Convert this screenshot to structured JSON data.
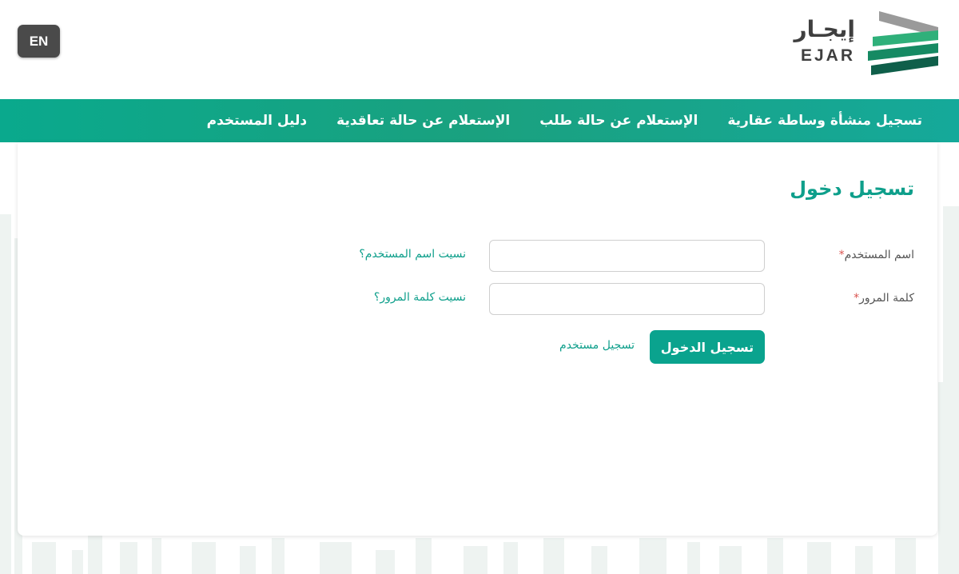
{
  "header": {
    "language_button": "EN",
    "logo_arabic": "إيجـار",
    "logo_latin": "EJAR"
  },
  "nav": {
    "items": [
      {
        "label": "تسجيل منشأة وساطة عقارية"
      },
      {
        "label": "الإستعلام عن حالة طلب"
      },
      {
        "label": "الإستعلام عن حالة تعاقدية"
      },
      {
        "label": "دليل المستخدم"
      }
    ]
  },
  "login": {
    "title": "تسجيل دخول",
    "username_label": "اسم المستخدم",
    "username_value": "",
    "password_label": "كلمة المرور",
    "password_value": "",
    "required_marker": "*",
    "forgot_username": "نسيت اسم المستخدم؟",
    "forgot_password": "نسيت كلمة المرور؟",
    "login_button": "تسجيل الدخول",
    "register_link": "تسجيل مستخدم"
  },
  "colors": {
    "brand_green": "#0aa38e",
    "nav_green": "#1aa17f",
    "logo_dark": "#3f3f3f",
    "language_button_bg": "#4a4a4a",
    "required_red": "#d9534f"
  }
}
